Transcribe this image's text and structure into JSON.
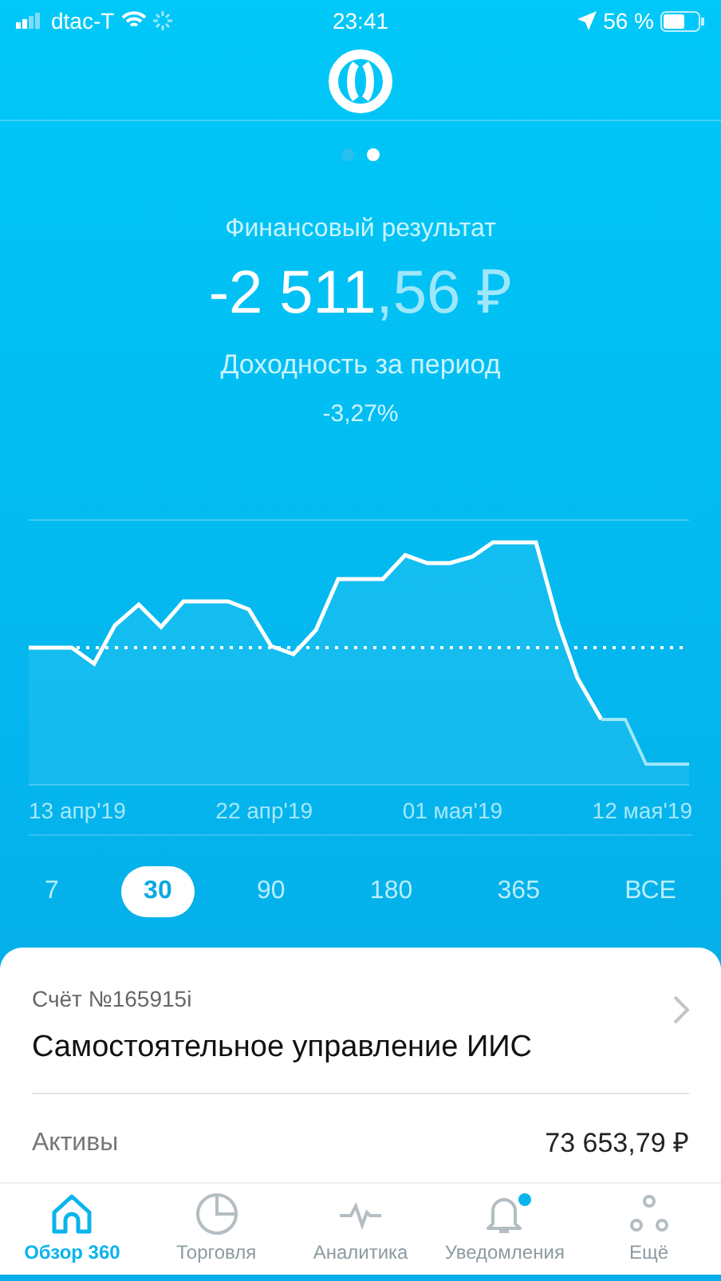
{
  "status_bar": {
    "carrier": "dtac-T",
    "time": "23:41",
    "battery": "56 %"
  },
  "page_dots": [
    {
      "selected": false
    },
    {
      "selected": true
    }
  ],
  "summary": {
    "title": "Финансовый результат",
    "amount_whole": "-2 511",
    "amount_fraction": ",56 ₽",
    "yield_label": "Доходность за период",
    "yield_value": "-3,27%"
  },
  "chart": {
    "x_labels": [
      "13 апр'19",
      "22 апр'19",
      "01 мая'19",
      "12 мая'19"
    ]
  },
  "periods": [
    {
      "label": "7",
      "selected": false
    },
    {
      "label": "30",
      "selected": true
    },
    {
      "label": "90",
      "selected": false
    },
    {
      "label": "180",
      "selected": false
    },
    {
      "label": "365",
      "selected": false
    },
    {
      "label": "ВСЕ",
      "selected": false
    }
  ],
  "account": {
    "number": "Счёт №165915i",
    "name": "Самостоятельное управление ИИС",
    "assets_label": "Активы",
    "assets_value": "73 653,79 ₽"
  },
  "tabs": [
    {
      "label": "Обзор 360",
      "selected": true,
      "badge": false
    },
    {
      "label": "Торговля",
      "selected": false,
      "badge": false
    },
    {
      "label": "Аналитика",
      "selected": false,
      "badge": false
    },
    {
      "label": "Уведомления",
      "selected": false,
      "badge": true
    },
    {
      "label": "Ещё",
      "selected": false,
      "badge": false
    }
  ]
}
